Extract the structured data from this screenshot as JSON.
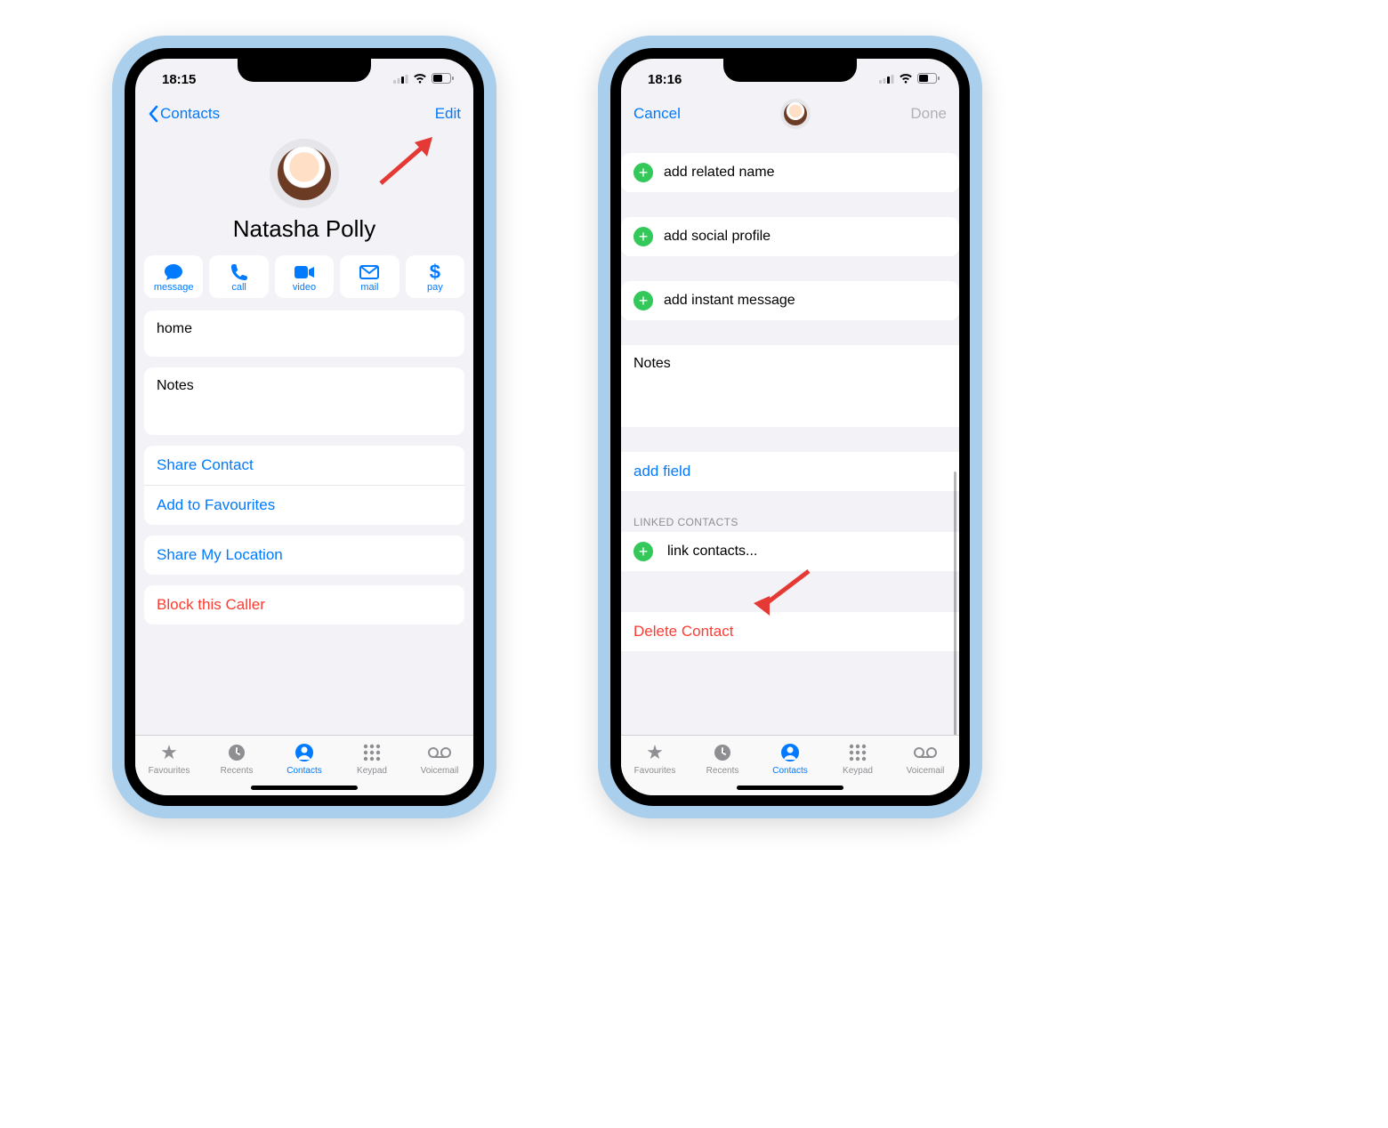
{
  "left": {
    "status_time": "18:15",
    "nav_back": "Contacts",
    "nav_edit": "Edit",
    "contact_name": "Natasha Polly",
    "actions": {
      "message": "message",
      "call": "call",
      "video": "video",
      "mail": "mail",
      "pay": "pay"
    },
    "home_label": "home",
    "notes_label": "Notes",
    "share_contact": "Share Contact",
    "add_favourites": "Add to Favourites",
    "share_location": "Share My Location",
    "block_caller": "Block this Caller"
  },
  "right": {
    "status_time": "18:16",
    "nav_cancel": "Cancel",
    "nav_done": "Done",
    "add_related": "add related name",
    "add_social": "add social profile",
    "add_im": "add instant message",
    "notes_label": "Notes",
    "add_field": "add field",
    "linked_header": "LINKED CONTACTS",
    "link_contacts": "link contacts...",
    "delete_contact": "Delete Contact"
  },
  "tabs": {
    "favourites": "Favourites",
    "recents": "Recents",
    "contacts": "Contacts",
    "keypad": "Keypad",
    "voicemail": "Voicemail"
  }
}
